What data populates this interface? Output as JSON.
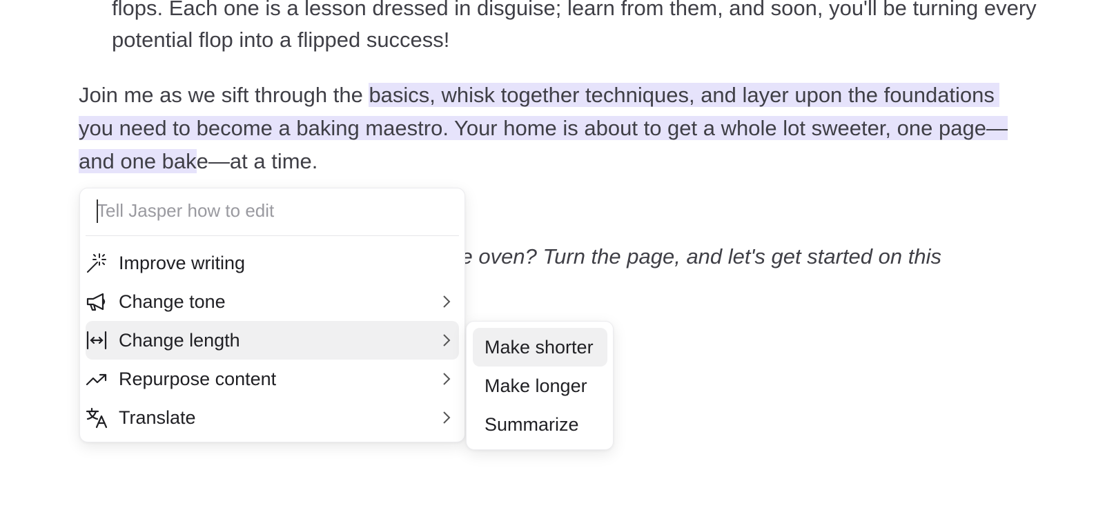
{
  "document": {
    "line1": "flops. Each one is a lesson dressed in disguise; learn from them, and soon, you'll be turning every",
    "line2": "potential flop into a flipped success!",
    "para2_line1_unselected": "Join me as we sift through the ",
    "para2_line1_selected": "basics, whisk together techniques, and layer upon the foundations",
    "para2_line2_selected": "you need to become a baking maestro. Your home is about to get a whole lot sweeter, one page—",
    "para2_line3_selected": "and one bak",
    "para2_line3_unselected": "e—at a time.",
    "italic_visible": "eat the oven? Turn the page, and let's get started on this"
  },
  "edit_menu": {
    "input_placeholder": "Tell Jasper how to edit",
    "input_value": "",
    "items": [
      {
        "label": "Improve writing",
        "icon": "magic-wand-icon",
        "has_submenu": false
      },
      {
        "label": "Change tone",
        "icon": "megaphone-icon",
        "has_submenu": true
      },
      {
        "label": "Change length",
        "icon": "expand-horizontal-icon",
        "has_submenu": true,
        "active": true
      },
      {
        "label": "Repurpose content",
        "icon": "trending-up-icon",
        "has_submenu": true
      },
      {
        "label": "Translate",
        "icon": "translate-icon",
        "has_submenu": true
      }
    ]
  },
  "length_submenu": {
    "items": [
      {
        "label": "Make shorter",
        "active": true
      },
      {
        "label": "Make longer"
      },
      {
        "label": "Summarize"
      }
    ]
  },
  "colors": {
    "selection_highlight": "#e6e3fb",
    "active_item_bg": "#f0f0f1",
    "text": "#3f3f46"
  }
}
